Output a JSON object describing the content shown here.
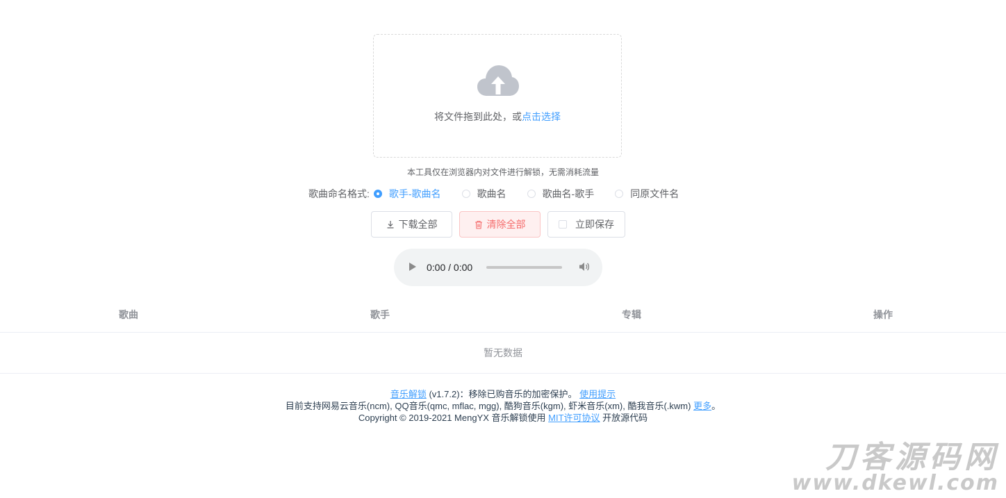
{
  "upload": {
    "icon": "cloud-upload-icon",
    "text_prefix": "将文件拖到此处，或",
    "link_text": "点击选择",
    "tip": "本工具仅在浏览器内对文件进行解锁，无需消耗流量"
  },
  "naming_format": {
    "label": "歌曲命名格式:",
    "options": [
      "歌手-歌曲名",
      "歌曲名",
      "歌曲名-歌手",
      "同原文件名"
    ],
    "selected": "歌手-歌曲名"
  },
  "actions": {
    "download_all": "下载全部",
    "clear_all": "清除全部",
    "save_now": "立即保存"
  },
  "player": {
    "time": "0:00 / 0:00"
  },
  "colors": {
    "accent": "#409eff",
    "danger": "#f56c6c"
  },
  "table": {
    "columns": [
      "歌曲",
      "歌手",
      "专辑",
      "操作"
    ],
    "empty_text": "暂无数据"
  },
  "footer": {
    "line1": {
      "link1": "音乐解锁",
      "text1": " (v1.7.2)：移除已购音乐的加密保护。 ",
      "link2": "使用提示"
    },
    "line2": {
      "text1": "目前支持网易云音乐(ncm), QQ音乐(qmc, mflac, mgg), 酷狗音乐(kgm), 虾米音乐(xm), 酷我音乐(.kwm) ",
      "link1": "更多",
      "text2": "。"
    },
    "line3": {
      "text1": "Copyright © 2019-2021 MengYX 音乐解锁使用 ",
      "link1": "MIT许可协议",
      "text2": " 开放源代码"
    }
  },
  "watermark": {
    "line1": "刀客源码网",
    "line2": "www.dkewl.com"
  }
}
